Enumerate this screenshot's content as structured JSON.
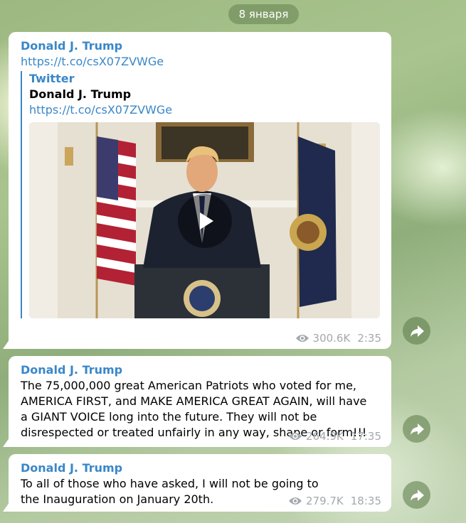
{
  "date_label": "8 января",
  "messages": [
    {
      "sender": "Donald J. Trump",
      "link": "https://t.co/csX07ZVWGe",
      "preview": {
        "site": "Twitter",
        "title": "Donald J. Trump",
        "link": "https://t.co/csX07ZVWGe"
      },
      "views": "300.6K",
      "time": "2:35"
    },
    {
      "sender": "Donald J. Trump",
      "text": "The 75,000,000 great American Patriots who voted for me, AMERICA FIRST, and MAKE AMERICA GREAT AGAIN, will have a GIANT VOICE long into the future. They will not be disrespected or treated unfairly in any way, shape or form!!!",
      "views": "264.9K",
      "time": "17:35"
    },
    {
      "sender": "Donald J. Trump",
      "text": "To all of those who have asked, I will not be going to the Inauguration on January 20th.",
      "views": "279.7K",
      "time": "18:35"
    }
  ],
  "icons": {
    "views": "eye-icon",
    "share": "share-arrow-icon",
    "play": "play-icon"
  }
}
